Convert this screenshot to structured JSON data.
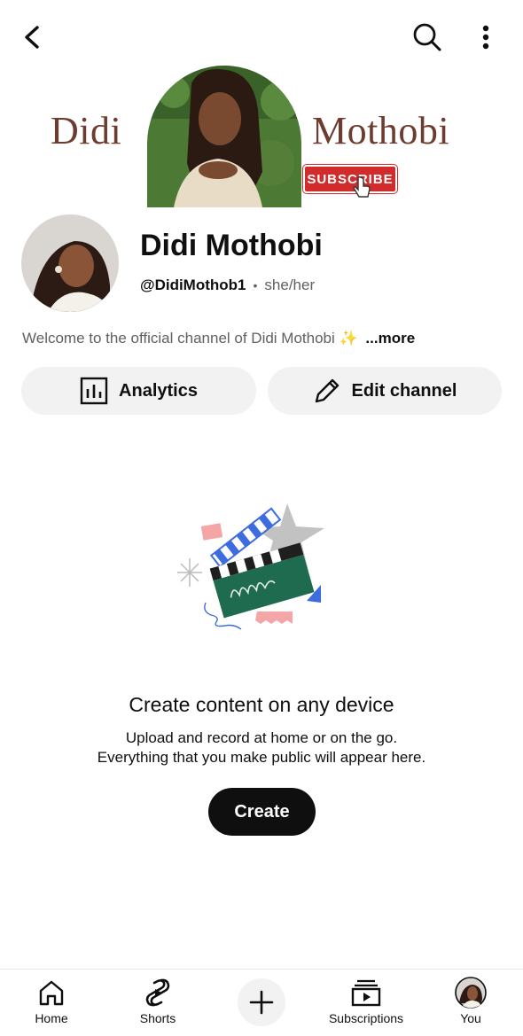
{
  "banner": {
    "left_text": "Didi",
    "right_text": "Mothobi",
    "subscribe_badge": "SUBSCRIBE"
  },
  "channel": {
    "name": "Didi Mothobi",
    "handle": "@DidiMothob1",
    "separator": "•",
    "pronouns": "she/her",
    "description": "Welcome to the official channel of Didi Mothobi ✨",
    "description_more": "...more"
  },
  "actions": {
    "analytics_label": "Analytics",
    "edit_label": "Edit channel"
  },
  "empty_state": {
    "title": "Create content on any device",
    "line1": "Upload and record at home or on the go.",
    "line2": "Everything that you make public will appear here.",
    "create_label": "Create"
  },
  "bottom_nav": {
    "items": [
      {
        "label": "Home",
        "icon": "home-icon"
      },
      {
        "label": "Shorts",
        "icon": "shorts-icon"
      },
      {
        "label": "",
        "icon": "plus-icon"
      },
      {
        "label": "Subscriptions",
        "icon": "subscriptions-icon"
      },
      {
        "label": "You",
        "icon": "avatar"
      }
    ]
  },
  "colors": {
    "banner_text": "#6e3b2f",
    "subscribe_red": "#d12b2b",
    "pill_bg": "#f2f2f2",
    "primary_text": "#0f0f0f",
    "secondary_text": "#606060"
  }
}
